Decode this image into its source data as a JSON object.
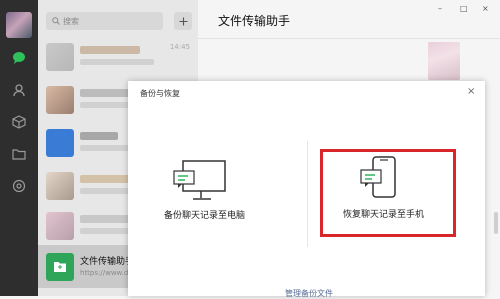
{
  "search": {
    "placeholder": "搜索"
  },
  "chat_list": {
    "items": [
      {
        "time": "14:45"
      },
      {
        "time": ""
      },
      {
        "time": ""
      },
      {
        "time": ""
      },
      {
        "time": ""
      },
      {
        "name": "文件传输助手",
        "preview": "https://www.d"
      }
    ]
  },
  "chat": {
    "title": "文件传输助手"
  },
  "dialog": {
    "title": "备份与恢复",
    "close": "×",
    "backup_label": "备份聊天记录至电脑",
    "restore_label": "恢复聊天记录至手机",
    "manage_link": "管理备份文件"
  },
  "window_controls": {
    "min": "–",
    "max": "□",
    "close": "×"
  },
  "colors": {
    "highlight": "#d9262a",
    "accent_green": "#2fa55a",
    "link": "#576b95"
  }
}
